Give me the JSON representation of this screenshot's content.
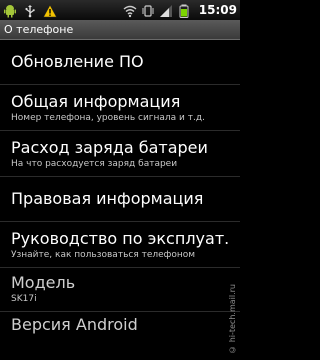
{
  "status_bar": {
    "time": "15:09",
    "left_icons": [
      "android-icon",
      "usb-icon",
      "warning-icon"
    ],
    "right_icons": [
      "wifi-icon",
      "vibrate-icon",
      "signal-icon",
      "battery-icon"
    ]
  },
  "header": {
    "title": "О телефоне"
  },
  "list": {
    "items": [
      {
        "title": "Обновление ПО"
      },
      {
        "title": "Общая информация",
        "subtitle": "Номер телефона, уровень сигнала и т.д."
      },
      {
        "title": "Расход заряда батареи",
        "subtitle": "На что расходуется заряд батареи"
      },
      {
        "title": "Правовая информация"
      },
      {
        "title": "Руководство по эксплуат.",
        "subtitle": "Узнайте, как пользоваться телефоном"
      },
      {
        "title": "Модель",
        "subtitle": "SK17i"
      },
      {
        "title": "Версия Android"
      }
    ]
  },
  "watermark": "© hi-tech.mail.ru",
  "colors": {
    "background": "#000000",
    "titlebar": "#4a4a4a",
    "statusbar": "#1a1a1a",
    "warning": "#f2c200"
  }
}
